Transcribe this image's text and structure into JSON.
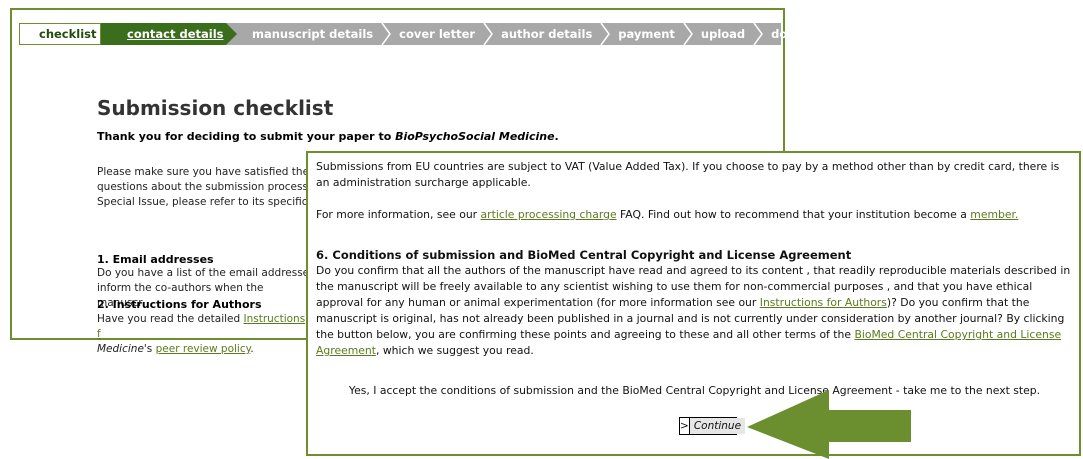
{
  "steps": [
    {
      "label": "checklist"
    },
    {
      "label": "contact details"
    },
    {
      "label": "manuscript details"
    },
    {
      "label": "cover letter"
    },
    {
      "label": "author details"
    },
    {
      "label": "payment"
    },
    {
      "label": "upload"
    },
    {
      "label": "done"
    }
  ],
  "back": {
    "title": "Submission checklist",
    "thanks_prefix": "Thank you for deciding to submit your paper to ",
    "journal": "BioPsychoSocial Medicine",
    "thanks_suffix": ".",
    "intro_1": "Please make sure you have satisfied the",
    "intro_2": "questions about the submission process,",
    "intro_3": "Special Issue, please refer to its specific",
    "email_heading": "1. Email addresses",
    "email_1": "Do you have a list of the email addresse",
    "email_2": "inform the co-authors when the manuscr",
    "instr_heading": "2. Instructions for Authors",
    "instr_1_prefix": "Have you read the detailed ",
    "instr_1_link": "Instructions f",
    "instr_2_journal": "Medicine",
    "instr_2_mid": "'s ",
    "instr_2_link": "peer review policy",
    "instr_2_suffix": "."
  },
  "front": {
    "vat": "Submissions from EU countries are subject to VAT (Value Added Tax). If you choose to pay by a method other than by credit card, there is an administration surcharge applicable.",
    "more_prefix": "For more information, see our ",
    "apc_link": "article processing charge",
    "more_mid": " FAQ. Find out how to recommend that your institution become a ",
    "member_link": "member.",
    "cond_heading": "6. Conditions of submission and BioMed Central Copyright and License Agreement",
    "cond_1": "Do you confirm that all the authors of the manuscript have read and agreed to its content , that readily reproducible materials described in the manuscript will be freely available to any scientist wishing to use them for non-commercial purposes , and that you have ethical approval for any human or animal experimentation (for more information see our ",
    "instr_link": "Instructions for Authors",
    "cond_2": ")? Do you confirm that the manuscript is original, has not already been published in a journal and is not currently under consideration by another journal? By clicking the button below, you are confirming these points and agreeing to these and all other terms of the ",
    "license_link": "BioMed Central Copyright and License Agreement",
    "cond_3": ", which we suggest you read.",
    "accept": "Yes, I accept the conditions of submission and the BioMed Central Copyright and License Agreement - take me to the next step.",
    "continue_arrow": ">",
    "continue_label": "Continue"
  },
  "colors": {
    "brand_green": "#3a6d1c",
    "border_green": "#6e8f2e",
    "link_green": "#5b7a1e",
    "arrow_green": "#6b8e2f",
    "step_grey": "#a8a8a8"
  },
  "icons": {
    "annotation_arrow": "large-left-arrow-icon",
    "step_separator": "chevron-right-icon"
  }
}
